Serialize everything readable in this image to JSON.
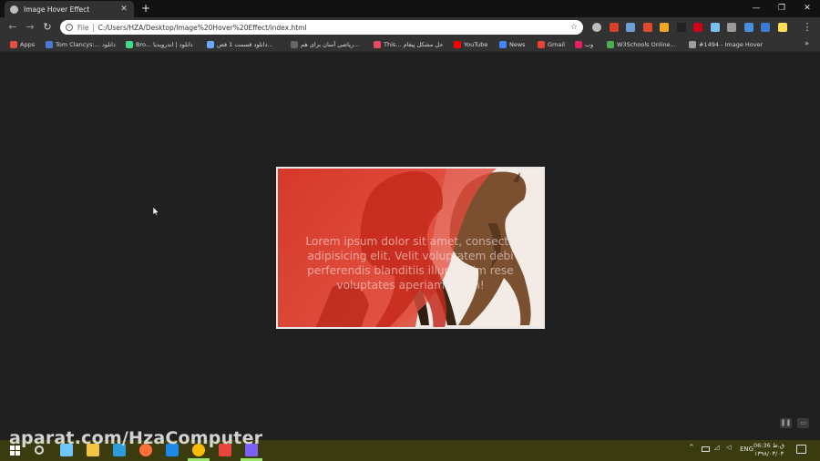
{
  "browser": {
    "tab_title": "Image Hover Effect",
    "close_tab": "✕",
    "new_tab": "+",
    "window_controls": [
      "—",
      "❐",
      "✕"
    ],
    "nav": {
      "back": "←",
      "forward": "→",
      "reload": "↻"
    },
    "address_scheme": "File",
    "address_url": "C:/Users/HZA/Desktop/Image%20Hover%20Effect/index.html",
    "star": "☆",
    "menu": "⋮",
    "extension_colors": [
      "#bdbdbd",
      "#d6402b",
      "#6ea0d8",
      "#e04a2c",
      "#f5a623",
      "#222222",
      "#d0021b",
      "#7ac0f0",
      "#9a9a9a",
      "#4a90e2",
      "#3a7bd5",
      "#ffde59"
    ],
    "bookmarks": [
      {
        "label": "Apps",
        "icon": "apps-grid-icon",
        "color": "#e74c3c"
      },
      {
        "label": "Tom Clancys:... دانلود",
        "icon": "site-favicon-icon",
        "color": "#4a7bd8"
      },
      {
        "label": "Bro... دانلود | اندرویدیا",
        "icon": "android-icon",
        "color": "#3ddc84"
      },
      {
        "label": "دانلود قسمت 1 فص...",
        "icon": "site-favicon-icon",
        "color": "#6aa9ff"
      },
      {
        "label": "ریاضی آسان برای هم...",
        "icon": "site-favicon-icon",
        "color": "#666666"
      },
      {
        "label": "This... حل مشکل پیغام",
        "icon": "heart-icon",
        "color": "#e84a5f"
      },
      {
        "label": "YouTube",
        "icon": "youtube-icon",
        "color": "#ff0000"
      },
      {
        "label": "News",
        "icon": "news-icon",
        "color": "#4285f4"
      },
      {
        "label": "Gmail",
        "icon": "gmail-icon",
        "color": "#ea4335"
      },
      {
        "label": "وب",
        "icon": "site-favicon-icon",
        "color": "#e91e63"
      },
      {
        "label": "W3Schools Online...",
        "icon": "w3schools-icon",
        "color": "#4caf50"
      },
      {
        "label": "#1494 - Image Hover",
        "icon": "site-favicon-icon",
        "color": "#9e9e9e"
      }
    ],
    "more_bookmarks": "»"
  },
  "page": {
    "card_text_lines": [
      "Lorem ipsum dolor sit amet, consecte",
      "adipisicing elit. Velit voluptatem debi",
      "perferendis blanditiis illum enim rese",
      "voluptates aperiam quam!"
    ]
  },
  "video": {
    "player_icons": [
      "❚❚",
      "▭"
    ]
  },
  "taskbar": {
    "watermark": "aparat.com/HzaComputer",
    "app_colors": [
      "#6fc6ff",
      "#f5c542",
      "#2d9cdb",
      "#ff7139",
      "#1e88e5",
      "#fbbc05",
      "#e8453c",
      "#7b61ff"
    ],
    "tray_chevron": "^",
    "language": "ENG",
    "clock_time": "06:36 ق.ظ",
    "clock_date": "۱۳۹۸/۰۳/۰۳"
  }
}
